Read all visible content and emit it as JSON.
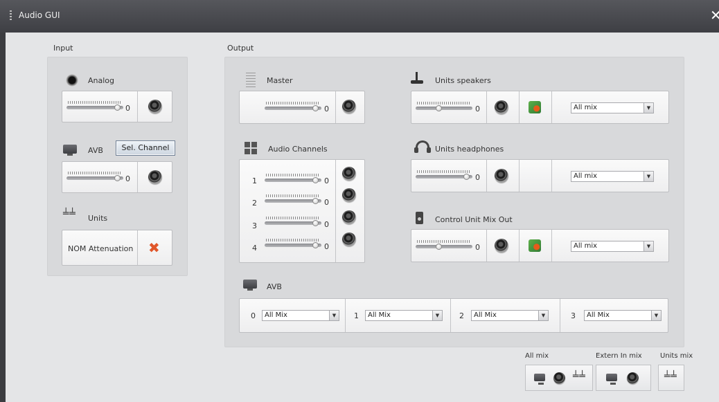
{
  "window": {
    "title": "Audio GUI",
    "close_glyph": "✕"
  },
  "input": {
    "label": "Input",
    "analog": {
      "label": "Analog",
      "value": "0",
      "level": 0.95
    },
    "avb": {
      "label": "AVB",
      "button": "Sel. Channel",
      "value": "0",
      "level": 0.95
    },
    "units": {
      "label": "Units",
      "nom_label": "NOM Attenuation",
      "icon": "close-x-icon"
    }
  },
  "output": {
    "label": "Output",
    "master": {
      "label": "Master",
      "value": "0",
      "level": 0.95
    },
    "audio_channels": {
      "label": "Audio Channels",
      "channels": [
        {
          "num": "1",
          "value": "0",
          "level": 0.95
        },
        {
          "num": "2",
          "value": "0",
          "level": 0.95
        },
        {
          "num": "3",
          "value": "0",
          "level": 0.95
        },
        {
          "num": "4",
          "value": "0",
          "level": 0.95
        }
      ]
    },
    "units_speakers": {
      "label": "Units speakers",
      "value": "0",
      "level": 0.4,
      "mix": "All mix"
    },
    "units_headphones": {
      "label": "Units headphones",
      "value": "0",
      "level": 0.95,
      "mix": "All mix"
    },
    "control_unit_mix_out": {
      "label": "Control Unit Mix Out",
      "value": "0",
      "level": 0.4,
      "mix": "All mix"
    },
    "avb": {
      "label": "AVB",
      "channels": [
        {
          "num": "0",
          "mix": "All Mix"
        },
        {
          "num": "1",
          "mix": "All Mix"
        },
        {
          "num": "2",
          "mix": "All Mix"
        },
        {
          "num": "3",
          "mix": "All Mix"
        }
      ]
    }
  },
  "mix_legend": {
    "all_mix": "All mix",
    "extern_in_mix": "Extern In mix",
    "units_mix": "Units mix"
  },
  "colors": {
    "titlebar": "#4a4b50",
    "background": "#e4e5e7",
    "accent_x": "#e0562a"
  }
}
